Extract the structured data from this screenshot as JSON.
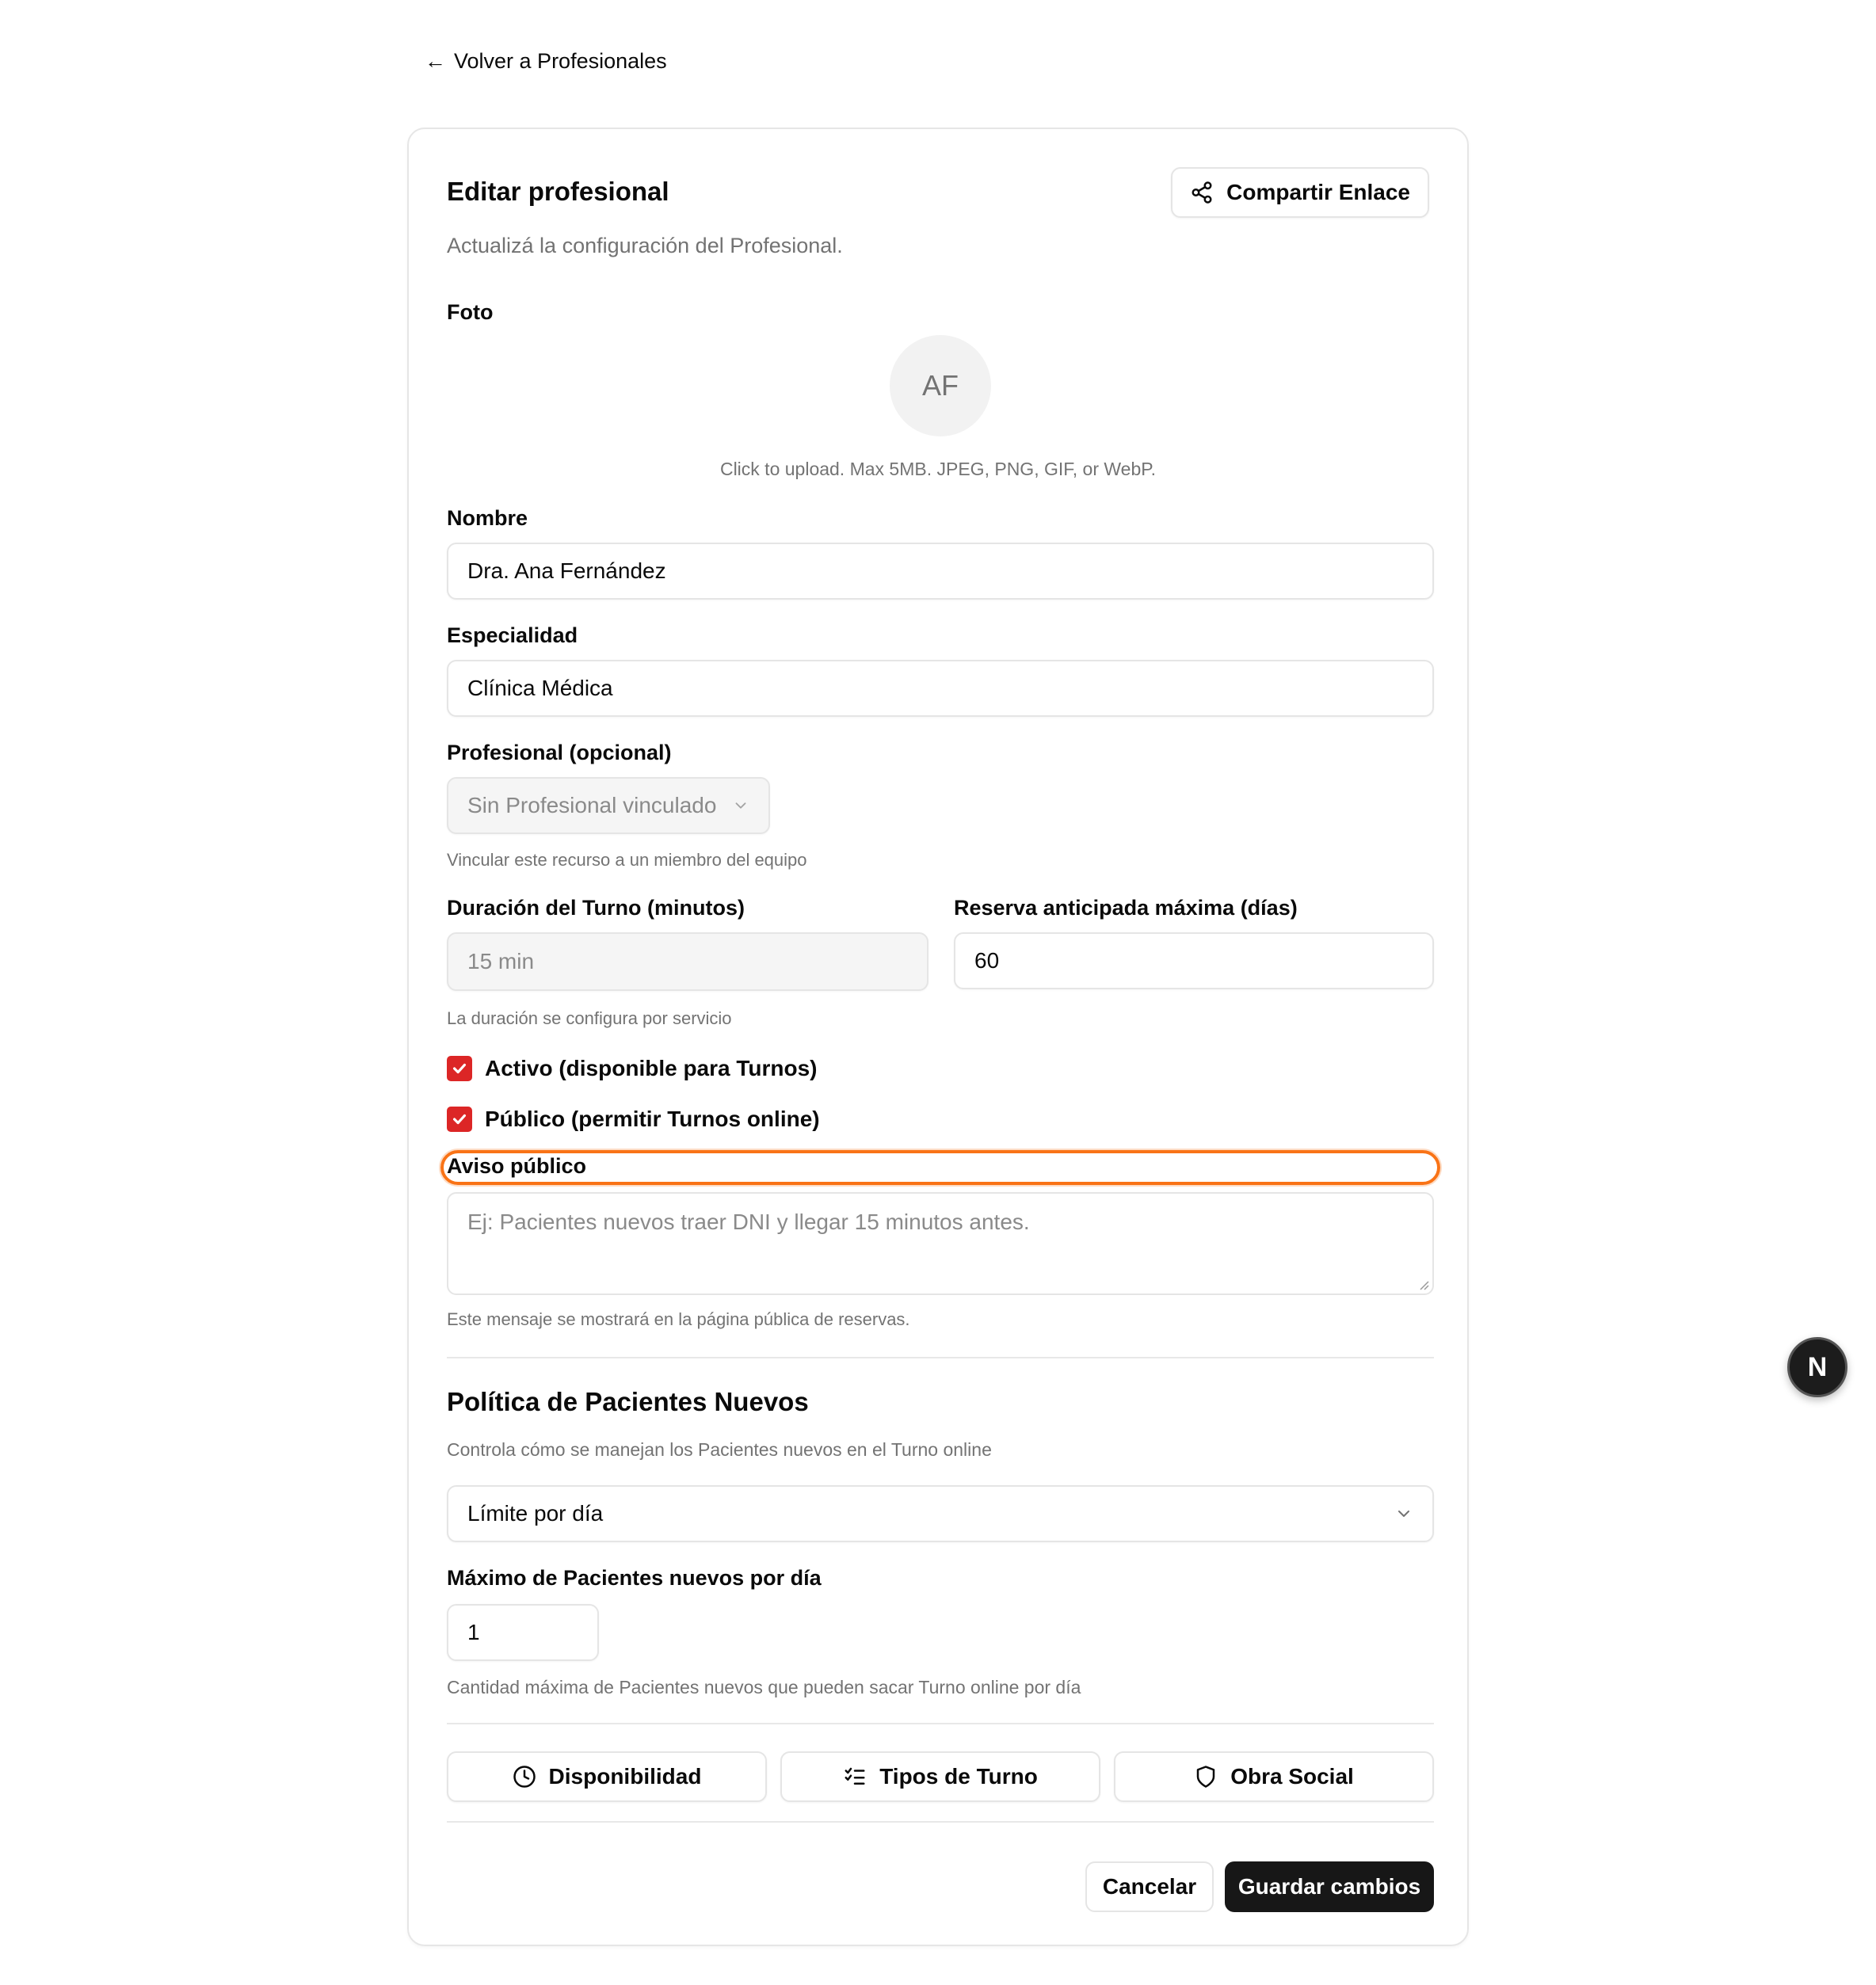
{
  "back_link": {
    "arrow": "←",
    "label": "Volver a Profesionales"
  },
  "header": {
    "title": "Editar profesional",
    "subtitle": "Actualizá la configuración del Profesional.",
    "share_button": "Compartir Enlace",
    "share_icon": "share-icon"
  },
  "photo": {
    "label": "Foto",
    "initials": "AF",
    "hint": "Click to upload. Max 5MB. JPEG, PNG, GIF, or WebP."
  },
  "nombre": {
    "label": "Nombre",
    "value": "Dra. Ana Fernández"
  },
  "especialidad": {
    "label": "Especialidad",
    "value": "Clínica Médica"
  },
  "profesional": {
    "label": "Profesional (opcional)",
    "selected": "Sin Profesional vinculado",
    "hint": "Vincular este recurso a un miembro del equipo"
  },
  "duracion": {
    "label": "Duración del Turno (minutos)",
    "value": "15 min",
    "hint": "La duración se configura por servicio"
  },
  "reserva": {
    "label": "Reserva anticipada máxima (días)",
    "value": "60"
  },
  "checkboxes": {
    "activo": {
      "label": "Activo (disponible para Turnos)",
      "checked": true
    },
    "publico": {
      "label": "Público (permitir Turnos online)",
      "checked": true
    }
  },
  "aviso": {
    "label": "Aviso público",
    "placeholder": "Ej: Pacientes nuevos traer DNI y llegar 15 minutos antes.",
    "hint": "Este mensaje se mostrará en la página pública de reservas."
  },
  "politica": {
    "title": "Política de Pacientes Nuevos",
    "subtitle": "Controla cómo se manejan los Pacientes nuevos en el Turno online",
    "selected": "Límite por día",
    "max_label": "Máximo de Pacientes nuevos por día",
    "max_value": "1",
    "max_hint": "Cantidad máxima de Pacientes nuevos que pueden sacar Turno online por día"
  },
  "nav_buttons": {
    "disponibilidad": "Disponibilidad",
    "tipos": "Tipos de Turno",
    "obra_social": "Obra Social"
  },
  "actions": {
    "cancel": "Cancelar",
    "save": "Guardar cambios"
  },
  "badge": {
    "letter": "N"
  },
  "colors": {
    "accent": "#dc2626",
    "focus": "#f97316",
    "primary_button": "#171717"
  }
}
